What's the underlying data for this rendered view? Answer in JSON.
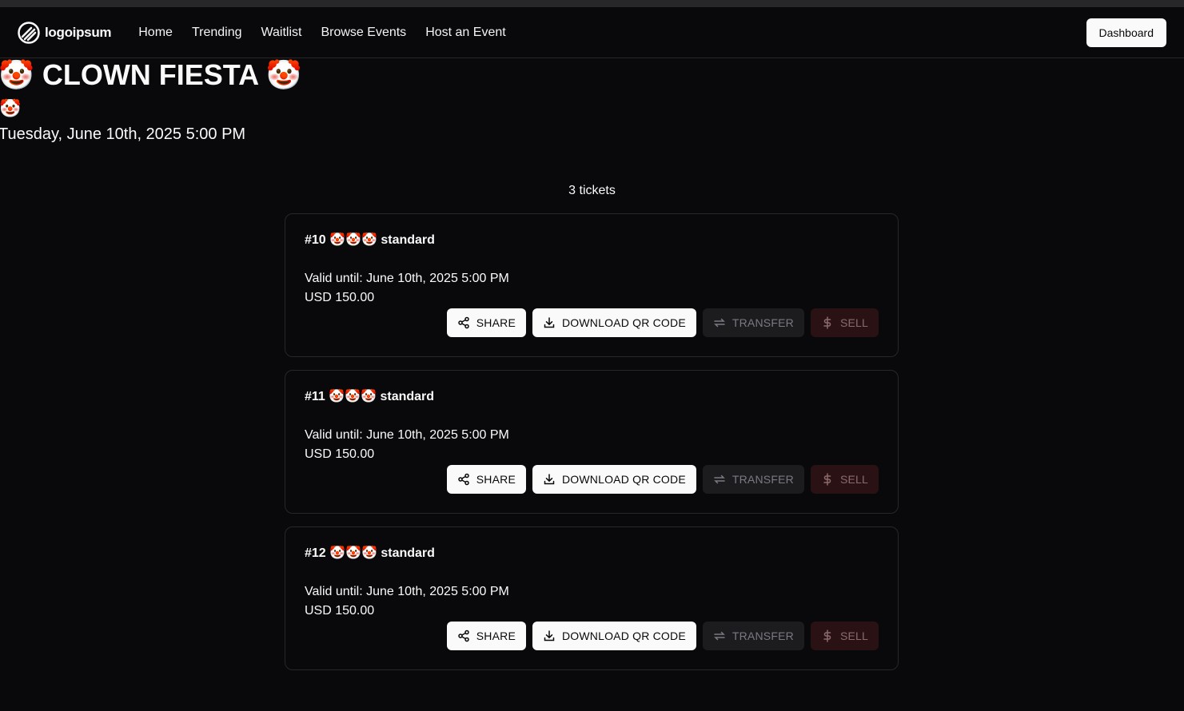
{
  "nav": {
    "logo_text": "logoipsum",
    "links": [
      "Home",
      "Trending",
      "Waitlist",
      "Browse Events",
      "Host an Event"
    ],
    "dashboard_label": "Dashboard"
  },
  "event": {
    "title": "🤡 CLOWN FIESTA 🤡",
    "emoji": "🤡",
    "date": "Tuesday, June 10th, 2025 5:00 PM"
  },
  "tickets_count": "3 tickets",
  "tickets": [
    {
      "title": "#10 🤡🤡🤡 standard",
      "valid": "Valid until: June 10th, 2025 5:00 PM",
      "price": "USD 150.00"
    },
    {
      "title": "#11 🤡🤡🤡 standard",
      "valid": "Valid until: June 10th, 2025 5:00 PM",
      "price": "USD 150.00"
    },
    {
      "title": "#12 🤡🤡🤡 standard",
      "valid": "Valid until: June 10th, 2025 5:00 PM",
      "price": "USD 150.00"
    }
  ],
  "actions": {
    "share": "SHARE",
    "download": "DOWNLOAD QR CODE",
    "transfer": "TRANSFER",
    "sell": "SELL"
  },
  "colors": {
    "background": "#09090b",
    "border": "#27272a",
    "primary_button": "#fafafa",
    "sell_button": "#2a1214"
  },
  "icons": [
    "share-icon",
    "download-icon",
    "transfer-icon",
    "dollar-icon"
  ]
}
